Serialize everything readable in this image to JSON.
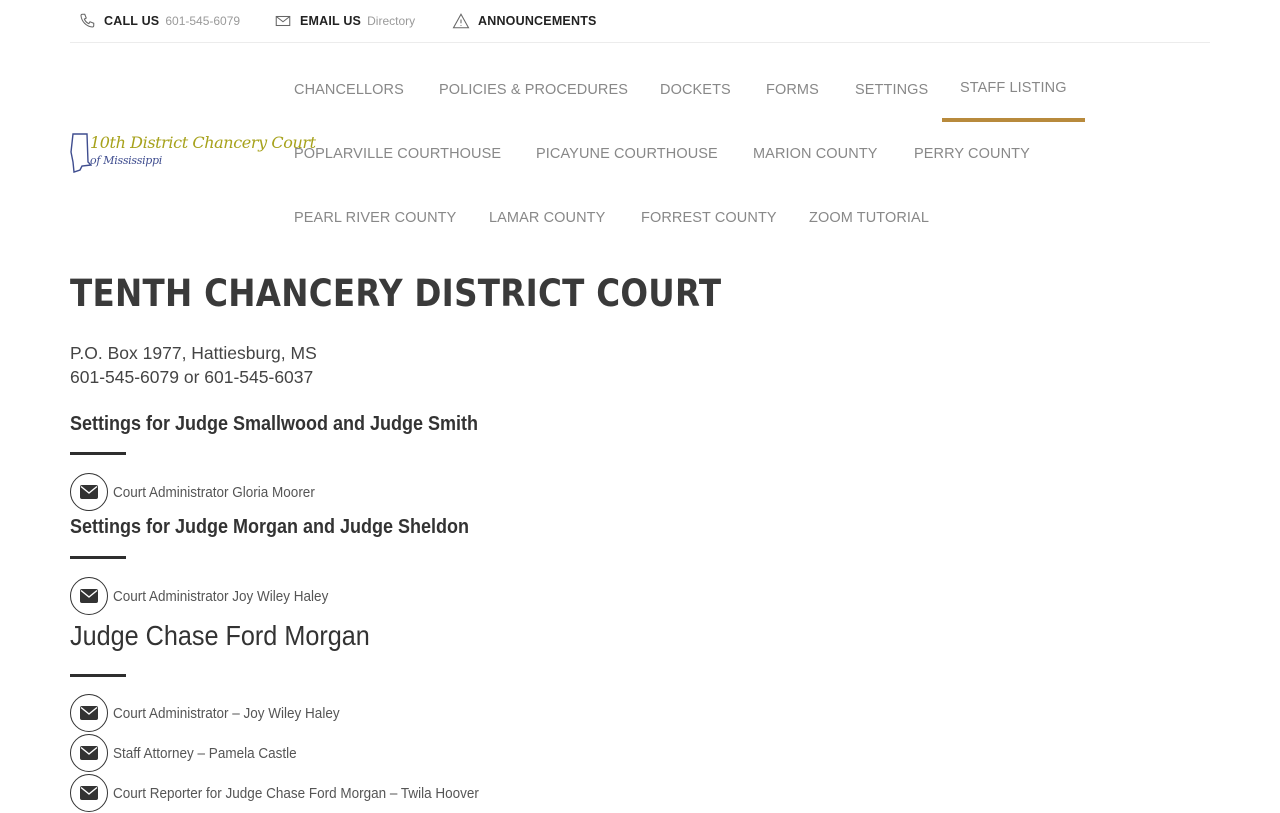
{
  "topbar": {
    "call_label": "CALL US",
    "call_value": "601-545-6079",
    "email_label": "EMAIL US",
    "email_value": "Directory",
    "announcements_label": "ANNOUNCEMENTS"
  },
  "logo": {
    "line1": "10th District Chancery Court",
    "line2": "of Mississippi"
  },
  "nav": {
    "row1": [
      "CHANCELLORS",
      "POLICIES & PROCEDURES",
      "DOCKETS",
      "FORMS",
      "SETTINGS",
      "STAFF LISTING"
    ],
    "row2": [
      "POPLARVILLE COURTHOUSE",
      "PICAYUNE COURTHOUSE",
      "MARION COUNTY",
      "PERRY COUNTY"
    ],
    "row3": [
      "PEARL RIVER COUNTY",
      "LAMAR COUNTY",
      "FORREST COUNTY",
      "ZOOM TUTORIAL"
    ],
    "active": "STAFF LISTING"
  },
  "main": {
    "title": "TENTH CHANCERY DISTRICT COURT",
    "address_line1": "P.O. Box 1977, Hattiesburg, MS",
    "address_line2": "601-545-6079 or 601-545-6037",
    "section1": {
      "heading": "Settings for Judge Smallwood and Judge Smith",
      "contact": "Court Administrator Gloria Moorer"
    },
    "section2": {
      "heading": "Settings for Judge Morgan and Judge Sheldon",
      "contact": "Court Administrator Joy Wiley Haley"
    },
    "judge": {
      "heading": "Judge Chase Ford Morgan",
      "contacts": [
        "Court Administrator – Joy Wiley Haley",
        "Staff Attorney – Pamela Castle",
        "Court Reporter for Judge Chase Ford Morgan – Twila Hoover"
      ]
    }
  },
  "colors": {
    "accent": "#b88a3c",
    "nav_text": "#888888",
    "logo_gold": "#a7a21c",
    "logo_blue": "#3f4d8f"
  }
}
